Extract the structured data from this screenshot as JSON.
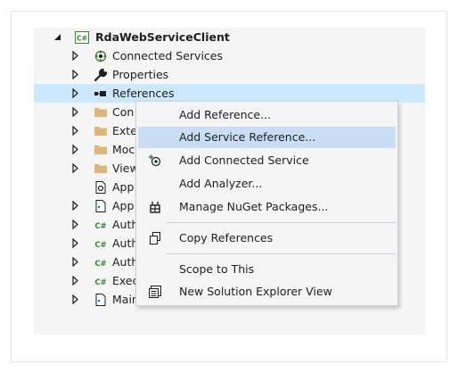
{
  "tree": {
    "root": {
      "label": "RdaWebServiceClient",
      "badge": "C#"
    },
    "items": [
      {
        "label": "Connected Services"
      },
      {
        "label": "Properties"
      },
      {
        "label": "References"
      },
      {
        "label": "Con"
      },
      {
        "label": "Exte"
      },
      {
        "label": "Moc"
      },
      {
        "label": "View"
      },
      {
        "label": "App"
      },
      {
        "label": "App"
      },
      {
        "label": "Auth",
        "badge": "C#"
      },
      {
        "label": "Auth",
        "badge": "C#"
      },
      {
        "label": "Auth",
        "badge": "C#"
      },
      {
        "label": "Exec",
        "badge": "C#"
      },
      {
        "label": "MainWindow.xaml"
      }
    ]
  },
  "context_menu": {
    "items": [
      {
        "label": "Add Reference...",
        "icon": "none"
      },
      {
        "label": "Add Service Reference...",
        "icon": "none",
        "highlighted": true
      },
      {
        "label": "Add Connected Service",
        "icon": "connected-service-icon"
      },
      {
        "label": "Add Analyzer...",
        "icon": "none"
      },
      {
        "label": "Manage NuGet Packages...",
        "icon": "nuget-icon"
      },
      {
        "label": "Copy References",
        "icon": "copy-icon"
      },
      {
        "label": "Scope to This",
        "icon": "none"
      },
      {
        "label": "New Solution Explorer View",
        "icon": "new-view-icon"
      }
    ]
  },
  "colors": {
    "selection": "#cce8ff",
    "menu_highlight": "#c9def5",
    "csharp_icon": "#388a34",
    "folder": "#dcb67a"
  }
}
